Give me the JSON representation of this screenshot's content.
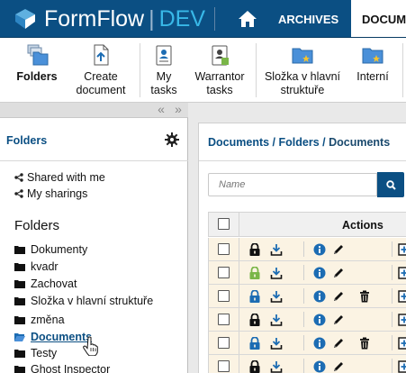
{
  "header": {
    "app_name": "FormFlow",
    "separator": "|",
    "environment": "DEV",
    "tabs": [
      {
        "label": "ARCHIVES"
      },
      {
        "label": "DOCUMENTS"
      }
    ],
    "brand_color": "#0b4f83",
    "accent_color": "#38b8e8"
  },
  "toolbar": {
    "items": [
      {
        "label": "Folders",
        "icon": "folders-icon",
        "bold": true
      },
      {
        "label": "Create document",
        "icon": "create-document-icon"
      },
      {
        "label": "My tasks",
        "icon": "my-tasks-icon"
      },
      {
        "label": "Warrantor tasks",
        "icon": "warrantor-tasks-icon"
      },
      {
        "label": "Složka v hlavní struktuře",
        "icon": "folder-star-icon"
      },
      {
        "label": "Interní",
        "icon": "folder-star-icon"
      }
    ]
  },
  "left_panel": {
    "collapse_left": "«",
    "collapse_right": "»",
    "title": "Folders",
    "share_links": [
      {
        "label": "Shared with me"
      },
      {
        "label": "My sharings"
      }
    ],
    "folders_heading": "Folders",
    "folders": [
      {
        "label": "Dokumenty"
      },
      {
        "label": "kvadr"
      },
      {
        "label": "Zachovat"
      },
      {
        "label": "Složka v hlavní struktuře"
      },
      {
        "label": "změna"
      },
      {
        "label": "Documents",
        "active": true
      },
      {
        "label": "Testy"
      },
      {
        "label": "Ghost Inspector"
      }
    ]
  },
  "main": {
    "breadcrumb": {
      "part1": "Documents",
      "sep1": " / ",
      "part2": "Folders",
      "sep2": " / ",
      "current": "Documents"
    },
    "search": {
      "placeholder": "Name"
    },
    "grid": {
      "actions_header": "Actions",
      "rows": [
        {
          "lock_color": "#111111",
          "delete": false
        },
        {
          "lock_color": "#7ab648",
          "delete": false
        },
        {
          "lock_color": "#1c6cb3",
          "delete": true
        },
        {
          "lock_color": "#111111",
          "delete": false
        },
        {
          "lock_color": "#1c6cb3",
          "delete": true
        },
        {
          "lock_color": "#111111",
          "delete": false
        }
      ]
    }
  }
}
